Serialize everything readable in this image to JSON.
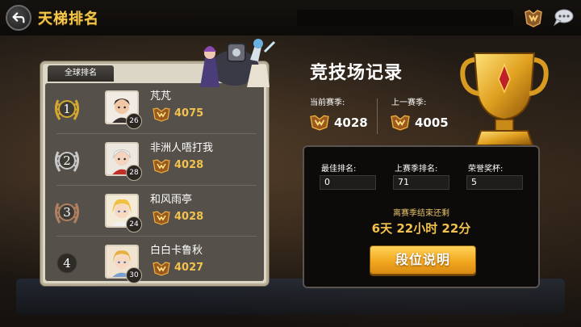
{
  "header": {
    "title": "天梯排名",
    "back_icon": "back-arrow-icon",
    "right_icons": [
      "rank-emblem-icon",
      "chat-bubble-icon"
    ]
  },
  "leaderboard": {
    "tab_label": "全球排名",
    "entries": [
      {
        "rank": "1",
        "badge": "gold",
        "name": "芃芃",
        "level": "26",
        "score": "4075"
      },
      {
        "rank": "2",
        "badge": "silver",
        "name": "非洲人唔打我",
        "level": "28",
        "score": "4028"
      },
      {
        "rank": "3",
        "badge": "bronze",
        "name": "和风雨亭",
        "level": "24",
        "score": "4028"
      },
      {
        "rank": "4",
        "badge": "plain",
        "name": "白白卡鲁秋",
        "level": "30",
        "score": "4027"
      }
    ]
  },
  "arena": {
    "title": "竞技场记录",
    "current_season_label": "当前赛季:",
    "current_season_score": "4028",
    "last_season_label": "上一赛季:",
    "last_season_score": "4005",
    "stats": {
      "best_rank_label": "最佳排名:",
      "best_rank_value": "0",
      "last_rank_label": "上赛季排名:",
      "last_rank_value": "71",
      "honor_label": "荣誉奖杯:",
      "honor_value": "5"
    },
    "countdown_label": "离赛季结束还剩",
    "countdown_value": "6天 22小时 22分",
    "explain_button": "段位说明"
  },
  "colors": {
    "title_gold": "#f4c74b",
    "score_gold": "#f2c14e",
    "button_orange": "#f2a820",
    "panel_bg": "#55514a"
  }
}
